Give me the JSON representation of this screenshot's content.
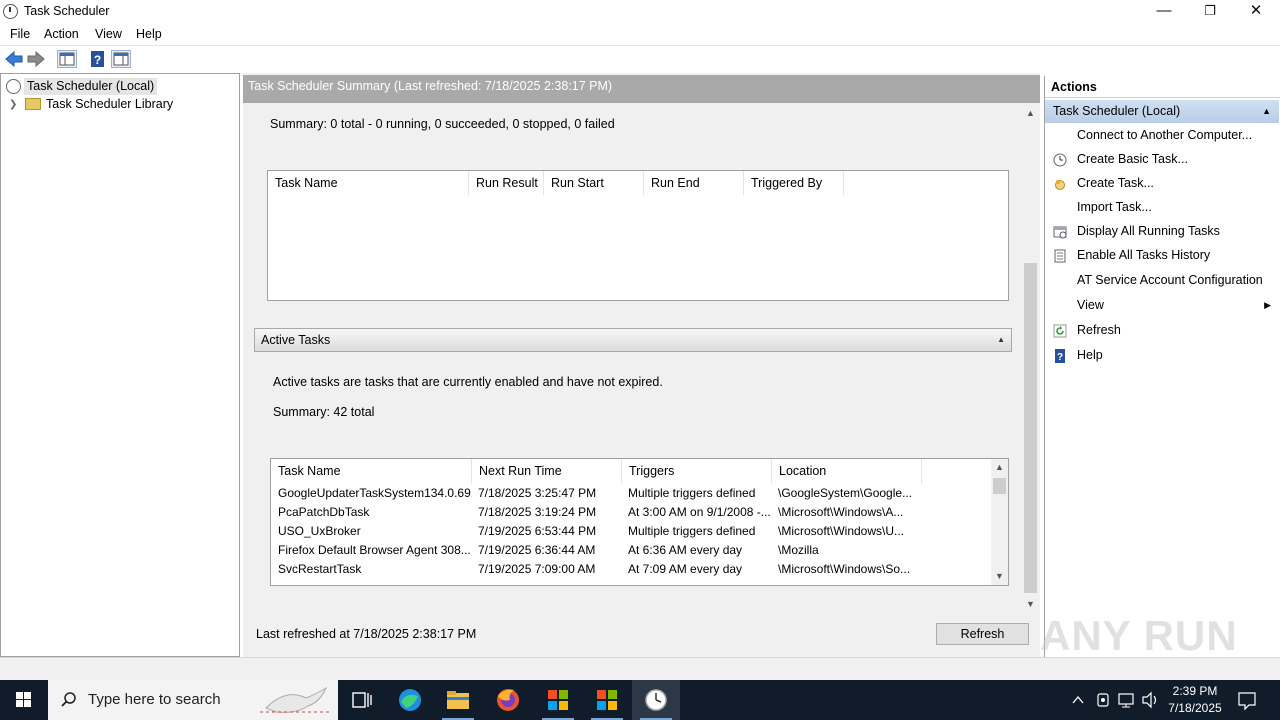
{
  "window": {
    "title": "Task Scheduler",
    "controls": {
      "minimize": "—",
      "restore": "❐",
      "close": "✕"
    }
  },
  "menu": [
    "File",
    "Action",
    "View",
    "Help"
  ],
  "tree": {
    "items": [
      {
        "label": "Task Scheduler (Local)",
        "selected": true
      },
      {
        "label": "Task Scheduler Library",
        "selected": false
      }
    ]
  },
  "center": {
    "header": "Task Scheduler Summary (Last refreshed: 7/18/2025 2:38:17 PM)",
    "summary_text": "Summary: 0 total - 0 running, 0 succeeded, 0 stopped, 0 failed",
    "status_columns": [
      "Task Name",
      "Run Result",
      "Run Start",
      "Run End",
      "Triggered By"
    ],
    "active_tasks": {
      "section_title": "Active Tasks",
      "description": "Active tasks are tasks that are currently enabled and have not expired.",
      "summary": "Summary: 42 total",
      "columns": [
        "Task Name",
        "Next Run Time",
        "Triggers",
        "Location"
      ],
      "rows": [
        [
          "GoogleUpdaterTaskSystem134.0.69...",
          "7/18/2025 3:25:47 PM",
          "Multiple triggers defined",
          "\\GoogleSystem\\Google..."
        ],
        [
          "PcaPatchDbTask",
          "7/18/2025 3:19:24 PM",
          "At 3:00 AM on 9/1/2008 -...",
          "\\Microsoft\\Windows\\A..."
        ],
        [
          "USO_UxBroker",
          "7/19/2025 6:53:44 PM",
          "Multiple triggers defined",
          "\\Microsoft\\Windows\\U..."
        ],
        [
          "Firefox Default Browser Agent 308...",
          "7/19/2025 6:36:44 AM",
          "At 6:36 AM every day",
          "\\Mozilla"
        ],
        [
          "SvcRestartTask",
          "7/19/2025 7:09:00 AM",
          "At 7:09 AM every day",
          "\\Microsoft\\Windows\\So..."
        ]
      ]
    },
    "footer": {
      "last_refreshed": "Last refreshed at 7/18/2025 2:38:17 PM",
      "refresh_button": "Refresh"
    }
  },
  "actions": {
    "title": "Actions",
    "group": "Task Scheduler (Local)",
    "items": [
      {
        "label": "Connect to Another Computer...",
        "icon": "none"
      },
      {
        "label": "Create Basic Task...",
        "icon": "basic-task-icon"
      },
      {
        "label": "Create Task...",
        "icon": "create-task-icon"
      },
      {
        "label": "Import Task...",
        "icon": "none"
      },
      {
        "label": "Display All Running Tasks",
        "icon": "running-tasks-icon"
      },
      {
        "label": "Enable All Tasks History",
        "icon": "history-icon"
      },
      {
        "label": "AT Service Account Configuration",
        "icon": "none"
      },
      {
        "label": "View",
        "icon": "none",
        "submenu": true
      },
      {
        "label": "Refresh",
        "icon": "refresh-icon"
      },
      {
        "label": "Help",
        "icon": "help-icon"
      }
    ]
  },
  "taskbar": {
    "search_placeholder": "Type here to search",
    "time": "2:39 PM",
    "date": "7/18/2025"
  },
  "watermark": "ANY RUN",
  "colors": {
    "header_gray": "#a9a9a9",
    "actions_group_blue": "#c3d6ec",
    "taskbar": "#101c2a"
  }
}
